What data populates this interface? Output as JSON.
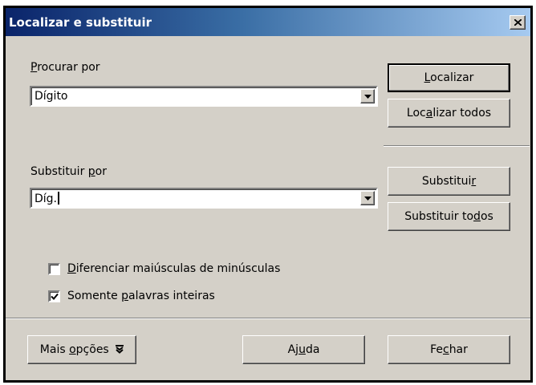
{
  "dialog": {
    "title": "Localizar e substituir"
  },
  "find": {
    "label_pre": "",
    "label_ul": "P",
    "label_post": "rocurar por",
    "value": "Dígito"
  },
  "replace": {
    "label_pre": "Substituir ",
    "label_ul": "p",
    "label_post": "or",
    "value": "Díg."
  },
  "buttons": {
    "find_pre": "",
    "find_ul": "L",
    "find_post": "ocalizar",
    "find_all_pre": "Loc",
    "find_all_ul": "a",
    "find_all_post": "lizar todos",
    "replace_pre": "Substitui",
    "replace_ul": "r",
    "replace_post": "",
    "replace_all_pre": "Substituir to",
    "replace_all_ul": "d",
    "replace_all_post": "os",
    "more_pre": "Mais ",
    "more_ul": "o",
    "more_post": "pções",
    "help_pre": "Aj",
    "help_ul": "u",
    "help_post": "da",
    "close_pre": "Fe",
    "close_ul": "c",
    "close_post": "har"
  },
  "options": {
    "match_case": {
      "pre": "",
      "ul": "D",
      "post": "iferenciar maiúsculas de minúsculas",
      "checked": false
    },
    "whole_words": {
      "pre": "Somente ",
      "ul": "p",
      "post": "alavras inteiras",
      "checked": true
    }
  },
  "icons": {
    "close": "close-icon",
    "dropdown": "chevron-down-icon",
    "more": "double-chevron-down-icon",
    "check": "checkmark-icon"
  }
}
